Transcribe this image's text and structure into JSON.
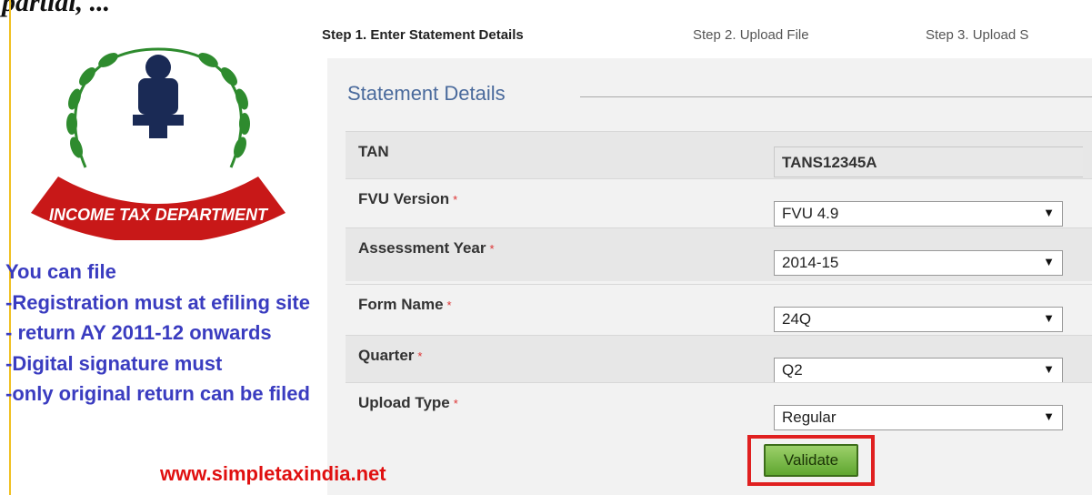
{
  "top_partial_text": "partial, ... ",
  "steps": {
    "step1": "Step 1. Enter Statement Details",
    "step2": "Step 2. Upload File",
    "step3": "Step 3. Upload S"
  },
  "section_title": "Statement Details",
  "rows": [
    {
      "label": "TAN",
      "required": false,
      "value": "TANS12345A",
      "kind": "readonly"
    },
    {
      "label": "FVU Version",
      "required": true,
      "value": "FVU 4.9",
      "kind": "select"
    },
    {
      "label": "Assessment Year",
      "required": true,
      "value": "2014-15",
      "kind": "select"
    },
    {
      "label": "Form Name",
      "required": true,
      "value": "24Q",
      "kind": "select"
    },
    {
      "label": "Quarter",
      "required": true,
      "value": "Q2",
      "kind": "select"
    },
    {
      "label": "Upload Type",
      "required": true,
      "value": "Regular",
      "kind": "select"
    }
  ],
  "required_mark": "*",
  "validate_label": "Validate",
  "emblem_text": "INCOME TAX DEPARTMENT",
  "notes": {
    "heading": "You can file",
    "line1": "-Registration must at efiling site",
    "line2": "- return AY 2011-12 onwards",
    "line3": "-Digital signature must",
    "line4": "-only original return can be filed"
  },
  "website": "www.simpletaxindia.net",
  "colors": {
    "accent_blue": "#3a3cc0",
    "title_blue": "#4a6a9c",
    "highlight_red": "#e02020",
    "button_green": "#5fa630",
    "emblem_green": "#2e8b2e",
    "ribbon_red": "#c81818"
  }
}
